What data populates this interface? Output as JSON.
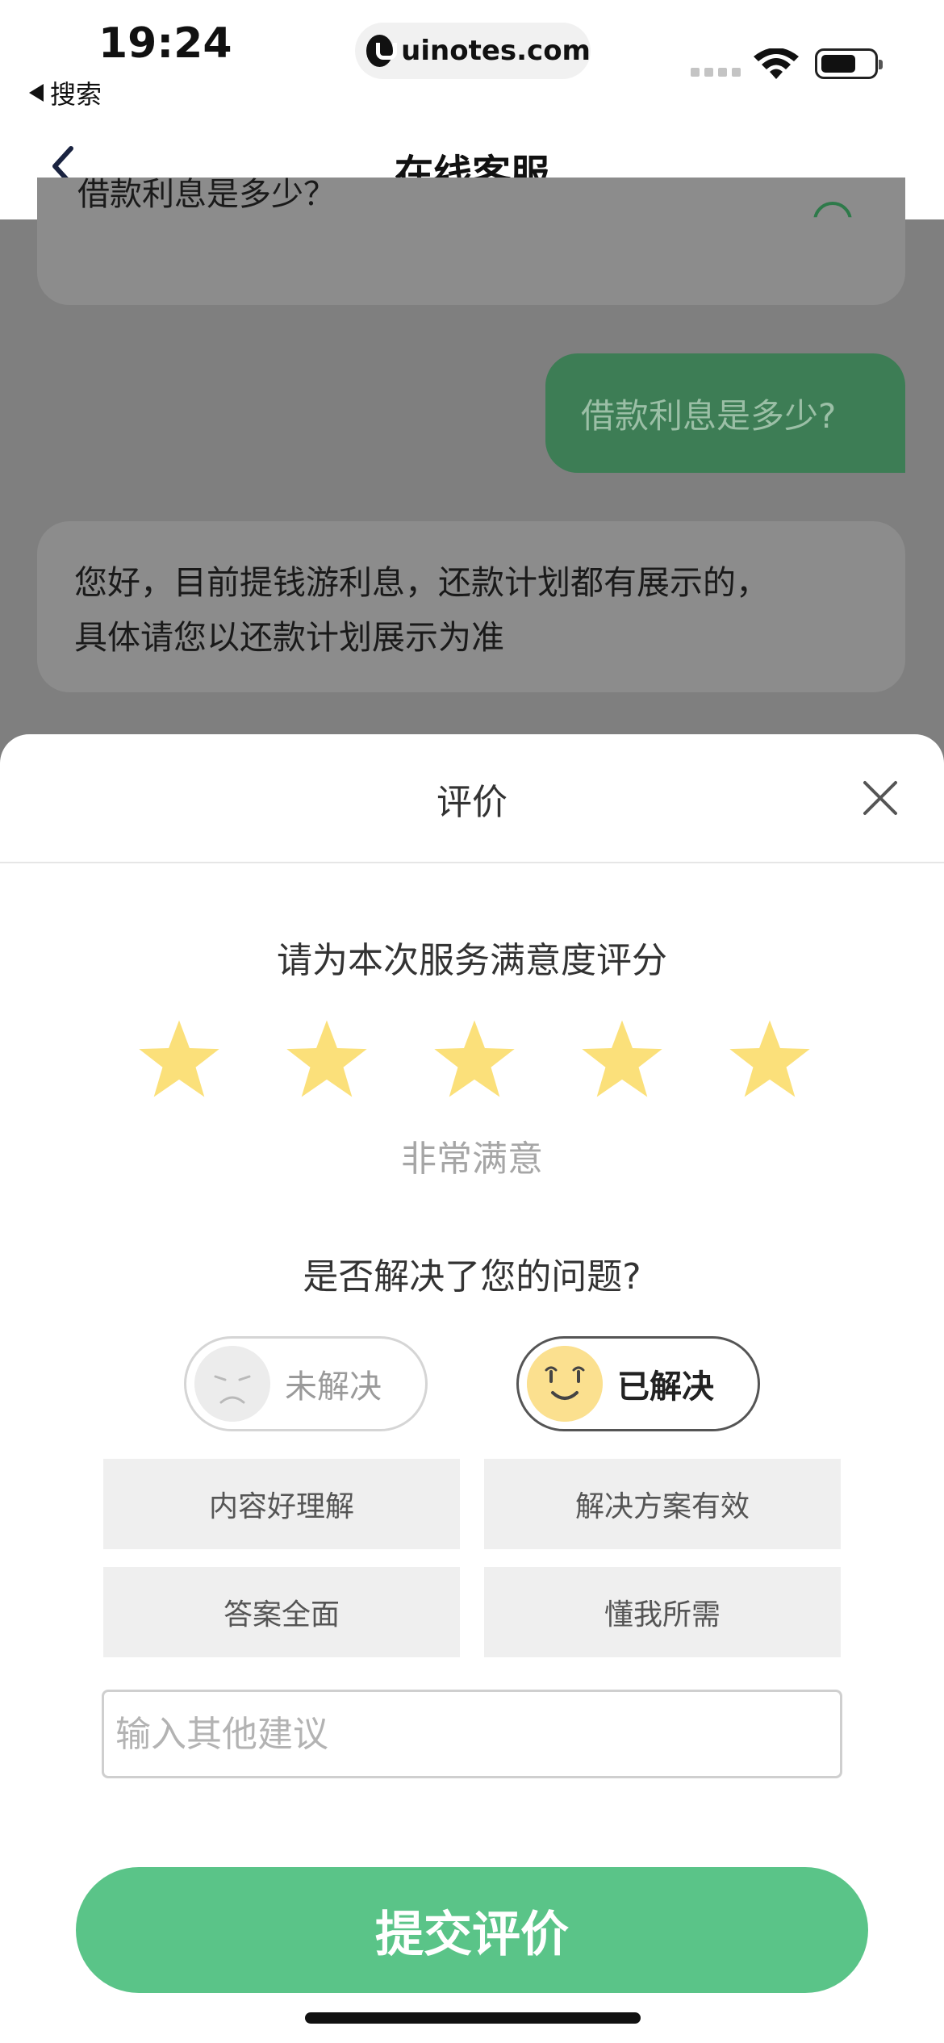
{
  "status_bar": {
    "time": "19:24",
    "back_label": "搜索",
    "url": "uinotes.com"
  },
  "nav": {
    "title": "在线客服"
  },
  "chat": {
    "messages": [
      {
        "side": "left",
        "text": "借款利息是多少？"
      },
      {
        "side": "right",
        "text": "借款利息是多少?"
      },
      {
        "side": "left",
        "lines": [
          "您好，目前提钱游利息，还款计划都有展示的，",
          "具体请您以还款计划展示为准"
        ]
      }
    ]
  },
  "rating_sheet": {
    "title": "评价",
    "rating_prompt": "请为本次服务满意度评分",
    "rating": 5,
    "rating_max": 5,
    "rating_label": "非常满意",
    "resolved_prompt": "是否解决了您的问题?",
    "unresolved_label": "未解决",
    "resolved_label": "已解决",
    "resolved_selected": true,
    "tags": [
      "内容好理解",
      "解决方案有效",
      "答案全面",
      "懂我所需"
    ],
    "suggestion_placeholder": "输入其他建议",
    "submit_label": "提交评价"
  },
  "colors": {
    "accent_green": "#5ac488",
    "star_yellow": "#fbe07a",
    "bubble_green": "#3d7d55",
    "overlay_gray": "#7f7f7f"
  },
  "icons": {
    "close": "close-icon",
    "star": "star-icon",
    "back": "chevron-left-icon"
  }
}
